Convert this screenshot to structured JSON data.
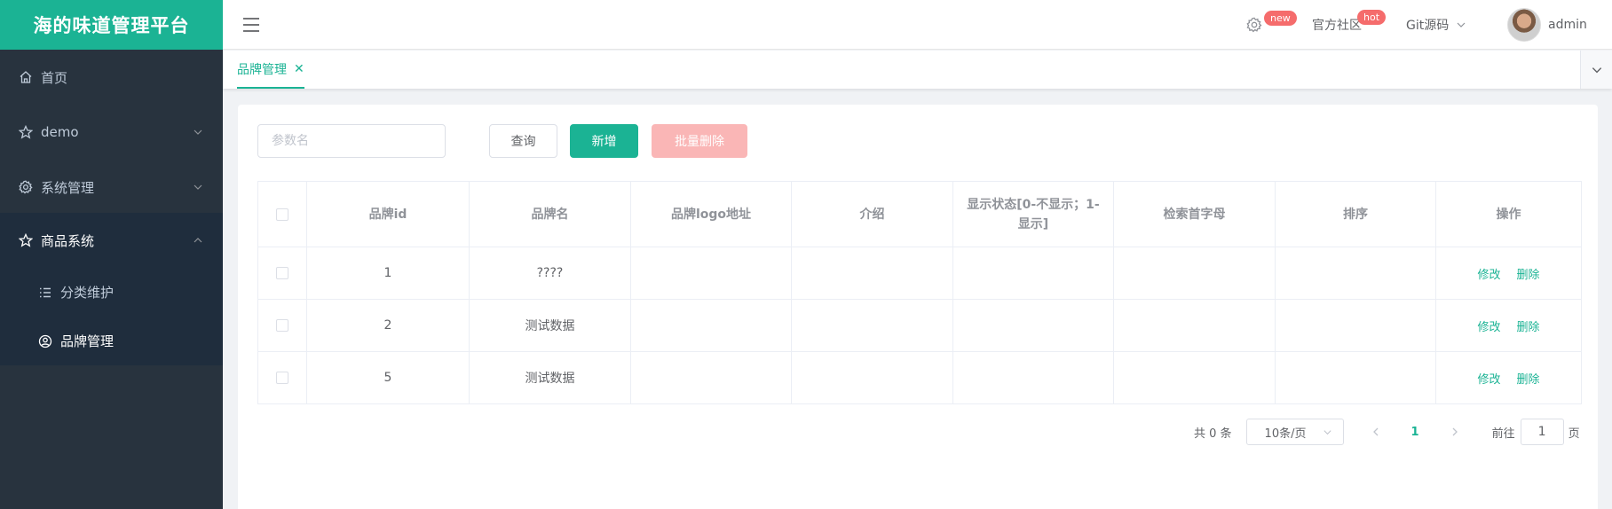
{
  "app": {
    "logo_text": "海的味道管理平台"
  },
  "sidebar": {
    "items": [
      {
        "label": "首页"
      },
      {
        "label": "demo"
      },
      {
        "label": "系统管理"
      },
      {
        "label": "商品系统"
      }
    ],
    "sub_items": [
      {
        "label": "分类维护"
      },
      {
        "label": "品牌管理"
      }
    ]
  },
  "header": {
    "settings_badge": "new",
    "community_label": "官方社区",
    "community_badge": "hot",
    "git_label": "Git源码",
    "username": "admin"
  },
  "tabs": [
    {
      "label": "品牌管理"
    }
  ],
  "toolbar": {
    "search_placeholder": "参数名",
    "query_label": "查询",
    "add_label": "新增",
    "batch_delete_label": "批量删除"
  },
  "table": {
    "columns": [
      "品牌id",
      "品牌名",
      "品牌logo地址",
      "介绍",
      "显示状态[0-不显示；1-显示]",
      "检索首字母",
      "排序",
      "操作"
    ],
    "rows": [
      {
        "id": "1",
        "name": "????",
        "logo": "",
        "intro": "",
        "status": "",
        "first_letter": "",
        "sort": ""
      },
      {
        "id": "2",
        "name": "测试数据",
        "logo": "",
        "intro": "",
        "status": "",
        "first_letter": "",
        "sort": ""
      },
      {
        "id": "5",
        "name": "测试数据",
        "logo": "",
        "intro": "",
        "status": "",
        "first_letter": "",
        "sort": ""
      }
    ],
    "edit_label": "修改",
    "delete_label": "删除"
  },
  "pagination": {
    "total_text": "共 0 条",
    "page_size": "10条/页",
    "current_page": "1",
    "goto_label": "前往",
    "goto_value": "1",
    "page_suffix": "页"
  },
  "colors": {
    "brand": "#1bb394",
    "sidebar_bg": "#28333e",
    "danger_light": "#fab6b6"
  }
}
